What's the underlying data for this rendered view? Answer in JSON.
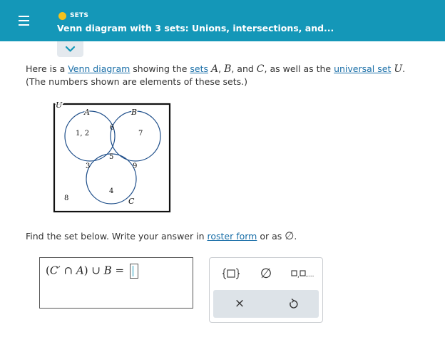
{
  "header": {
    "topic": "SETS",
    "title": "Venn diagram with 3 sets: Unions, intersections, and...",
    "colors": {
      "bar": "#1497b8",
      "topic_dot": "#f5c21b"
    }
  },
  "intro": {
    "part1": "Here is a ",
    "link_venn": "Venn diagram",
    "part2": " showing the ",
    "link_sets": "sets",
    "set_a": "A",
    "comma1": ", ",
    "set_b": "B",
    "part3": ", and ",
    "set_c": "C",
    "part4": ", as well as the ",
    "link_universal": "universal set",
    "set_u": "U",
    "period": ".",
    "line2": "(The numbers shown are elements of these sets.)"
  },
  "venn": {
    "universal_label": "U",
    "circle_labels": {
      "a": "A",
      "b": "B",
      "c": "C"
    },
    "elements": {
      "a_only": "1, 2",
      "a_and_b": "6",
      "b_only": "7",
      "a_b_c": "5",
      "a_and_c": "3",
      "b_and_c": "9",
      "c_only": "4",
      "outside": "8"
    }
  },
  "question": {
    "text": "Find the set below. Write your answer in ",
    "link": "roster form",
    "or_as": " or as ",
    "empty_symbol": "∅",
    "period": "."
  },
  "answer": {
    "lparen": "(",
    "c": "C",
    "prime": "′",
    "cap": " ∩ ",
    "a": "A",
    "rparen": ")",
    "cup": " ∪ ",
    "b": "B",
    "eq": " = "
  },
  "tools": {
    "braces_icon": "set-braces-icon",
    "empty_set": "∅",
    "list_icon": "element-list-icon",
    "clear_symbol": "×",
    "undo_icon": "undo-icon"
  }
}
